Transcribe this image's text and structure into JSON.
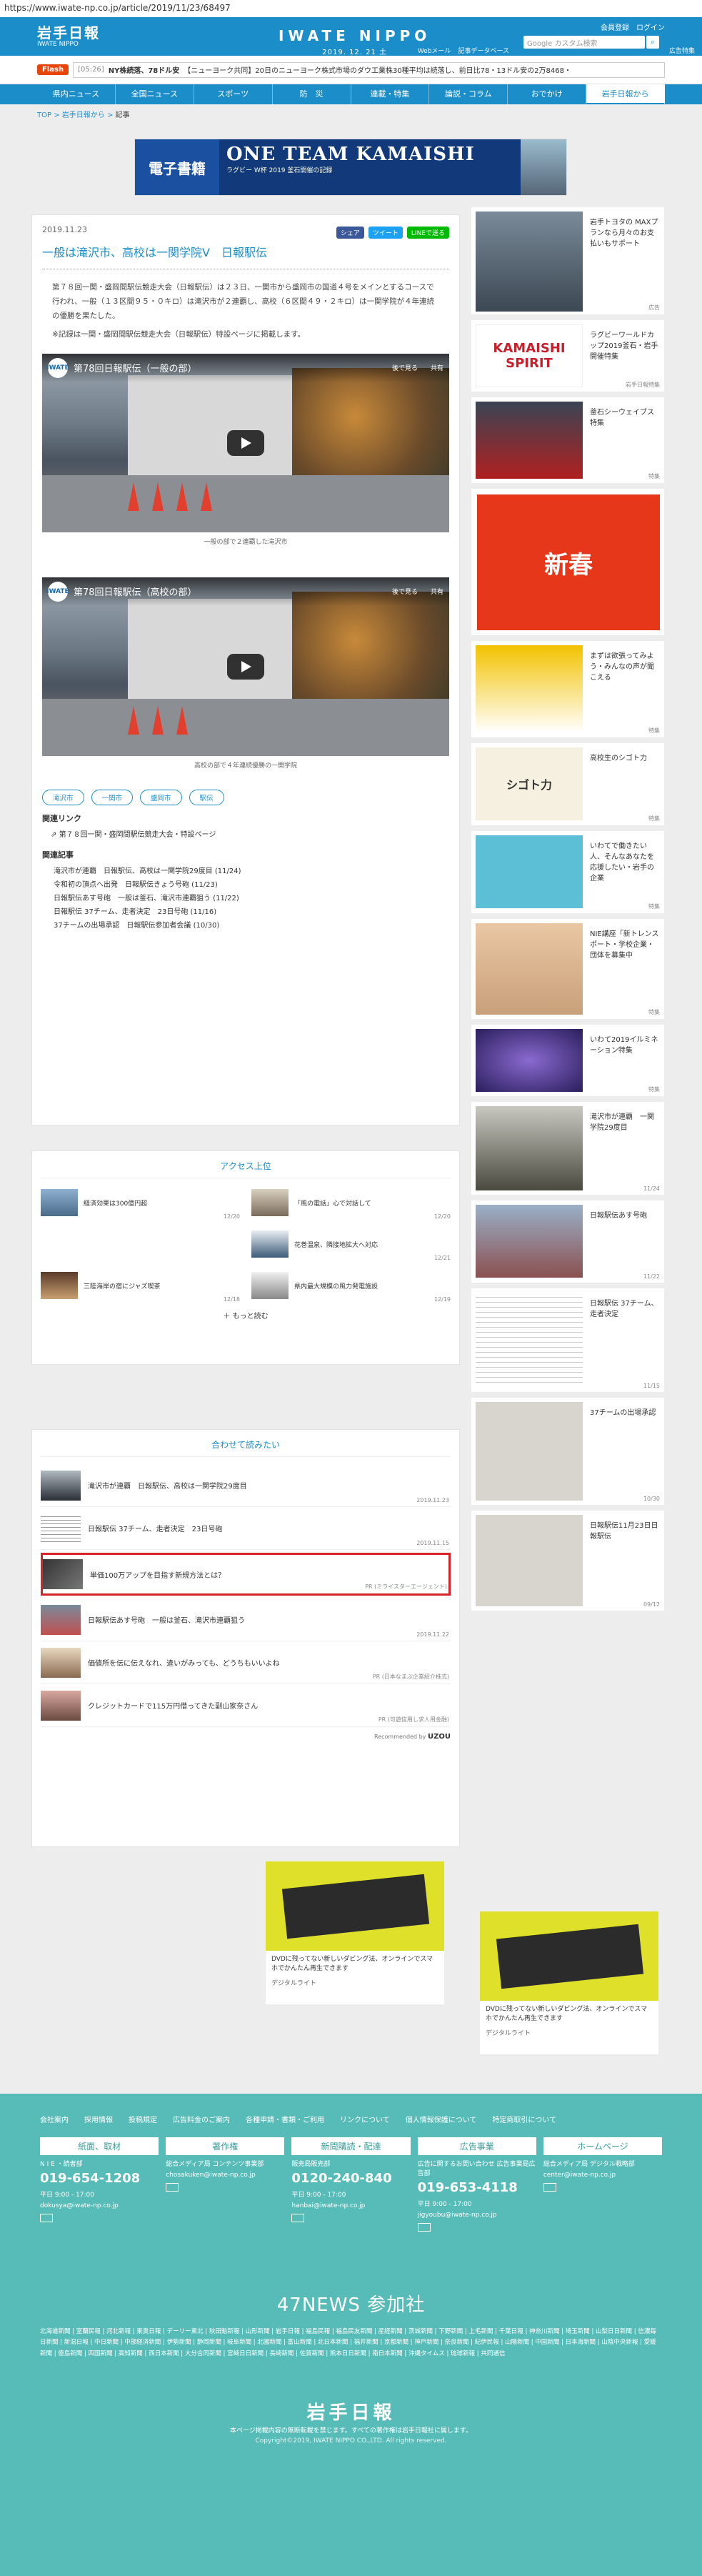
{
  "url": "https://www.iwate-np.co.jp/article/2019/11/23/68497",
  "header": {
    "logo": "岩手日報",
    "logo_sub": "IWATE NIPPO",
    "brand": "IWATE NIPPO",
    "date": "2019. 12. 21  土",
    "util_links": [
      "会員登録",
      "ログイン"
    ],
    "search_placeholder": "Google カスタム検索",
    "sub_links": [
      "Webメール",
      "記事データベース",
      "広告特集"
    ]
  },
  "ticker": {
    "flash_label": "Flash",
    "time": "[05:26]",
    "headline1": "NY株続落、78ドル安",
    "headline2": "【ニューヨーク共同】20日のニューヨーク株式市場のダウ工業株30種平均は続落し、前日比78・13ドル安の2万8468・"
  },
  "nav": [
    "県内ニュース",
    "全国ニュース",
    "スポーツ",
    "防　災",
    "連載・特集",
    "論説・コラム",
    "おでかけ",
    "岩手日報から"
  ],
  "breadcrumb": [
    "TOP",
    "岩手日報から",
    "記事"
  ],
  "banner": {
    "label": "電子書籍",
    "title": "ONE TEAM KAMAISHI",
    "sub": "ラグビー W杯 2019 釜石開催の記録"
  },
  "article": {
    "date": "2019.11.23",
    "share": [
      "シェア",
      "ツイート",
      "LINEで送る"
    ],
    "title": "一般は滝沢市、高校は一関学院V　日報駅伝",
    "body1": "第７８回一関・盛岡間駅伝競走大会（日報駅伝）は２３日、一関市から盛岡市の国道４号をメインとするコースで行われ、一般（１３区間９５・０キロ）は滝沢市が２連覇し、高校（６区間４９・２キロ）は一関学院が４年連続の優勝を果たした。",
    "body2": "※記録は一関・盛岡間駅伝競走大会（日報駅伝）特設ページに掲載します。",
    "videos": [
      {
        "title": "第78回日報駅伝（一般の部）",
        "caption": "一般の部で２連覇した滝沢市"
      },
      {
        "title": "第78回日報駅伝（高校の部）",
        "caption": "高校の部で４年連続優勝の一関学院"
      }
    ],
    "video_later": "後で見る",
    "video_share": "共有",
    "tags": [
      "滝沢市",
      "一関市",
      "盛岡市",
      "駅伝"
    ],
    "related_links_heading": "関連リンク",
    "related_link": "第７８回一関・盛岡間駅伝競走大会・特設ページ",
    "related_articles_heading": "関連記事",
    "related_articles": [
      "滝沢市が連覇　日報駅伝、高校は一関学院29度目 (11/24)",
      "令和初の頂点へ出発　日報駅伝きょう号砲 (11/23)",
      "日報駅伝あす号砲　一般は釜石、滝沢市連覇狙う (11/22)",
      "日報駅伝 37チーム、走者決定　23日号砲 (11/16)",
      "37チームの出場承認　日報駅伝参加者会議 (10/30)"
    ]
  },
  "access": {
    "heading": "アクセス上位",
    "items": [
      {
        "title": "経済効果は300億円超",
        "date": "12/20"
      },
      {
        "title": "「風の電話」心で対話して",
        "date": "12/20"
      },
      {
        "title": "",
        "date": ""
      },
      {
        "title": "花巻温泉、隣接地拡大へ対応",
        "date": "12/21"
      },
      {
        "title": "三陸海岸の宿にジャズ喫茶",
        "date": "12/18"
      },
      {
        "title": "県内最大規模の風力発電施設",
        "date": "12/19"
      }
    ],
    "more": "もっと読む"
  },
  "together": {
    "heading": "合わせて読みたい",
    "items": [
      {
        "title": "滝沢市が連覇　日報駅伝、高校は一関学院29度目",
        "date": "2019.11.23",
        "pr": ""
      },
      {
        "title": "日報駅伝 37チーム、走者決定　23日号砲",
        "date": "2019.11.15",
        "pr": ""
      },
      {
        "title": "単価100万アップを目指す新規方法とは？",
        "date": "",
        "pr": "PR (ミライスターエージェント)"
      },
      {
        "title": "日報駅伝あす号砲　一般は釜石、滝沢市連覇狙う",
        "date": "2019.11.22",
        "pr": ""
      },
      {
        "title": "価値所を伝に伝えなれ、違いがみっても、どうちもいいよね",
        "date": "",
        "pr": "PR (日本なまぶ企業紹介株式)"
      },
      {
        "title": "クレジットカードで115万円借ってきた副山家奈さん",
        "date": "",
        "pr": "PR (可遊信用し求人用金融)"
      }
    ],
    "recommended": "Recommended by",
    "uzou": "UZOU"
  },
  "ad": {
    "text": "DVDに残ってない新しいダビング法、オンラインでスマホでかんたん再生できます",
    "source": "デジタルライト"
  },
  "sidebar": [
    {
      "text": "岩手トヨタの MAXプランなら月々のお支払いもサポート",
      "label": "広告",
      "color": "#5b6a76"
    },
    {
      "text": "ラグビーワールドカップ2019釜石・岩手開催特集",
      "label": "岩手日報特集",
      "color": "#c71f2c"
    },
    {
      "text": "釜石シーウェイブス特集",
      "label": "特集",
      "color": "#3a4454"
    },
    {
      "text": "",
      "label": "",
      "color": "#e6371b"
    },
    {
      "text": "まずは欲張ってみよう・みんなの声が聞こえる",
      "label": "特集",
      "color": "#f2c200"
    },
    {
      "text": "高校生のシゴト力",
      "label": "特集",
      "color": "#f5f0df"
    },
    {
      "text": "いわてで働きたい人、そんなあなたを応援したい・岩手の企業",
      "label": "特集",
      "color": "#5cbfd5"
    },
    {
      "text": "NIE講座「新トレンスポート・学校企業・団体を募集中",
      "label": "特集",
      "color": "#eac7a4"
    },
    {
      "text": "いわて2019イルミネーション特集",
      "label": "特集",
      "color": "#2a1e5c"
    },
    {
      "text": "滝沢市が連覇　一関学院29度目",
      "label": "11/24",
      "color": "#8c8d7c"
    },
    {
      "text": "日報駅伝あす号砲",
      "label": "11/22",
      "color": "#5a7a9a"
    },
    {
      "text": "日報駅伝 37チーム、走者決定",
      "label": "11/15",
      "color": "#f7f7f7"
    },
    {
      "text": "37チームの出場承認",
      "label": "10/30",
      "color": "#d8d4ce"
    },
    {
      "text": "日報駅伝11月23日日報駅伝",
      "label": "09/12",
      "color": "#d8d4ce"
    }
  ],
  "footer": {
    "links": [
      "会社案内",
      "採用情報",
      "投稿規定",
      "広告料金のご案内",
      "各種申請・書類・ご利用",
      "リンクについて",
      "個人情報保護について",
      "特定商取引について"
    ],
    "columns": [
      {
        "title": "紙面、取材",
        "dept": "N I E ・読者部",
        "tel": "019-654-1208",
        "hours": "平日 9:00 - 17:00",
        "mail": "dokusya@iwate-np.co.jp"
      },
      {
        "title": "著作権",
        "dept": "総合メディア局 コンテンツ事業部",
        "tel": "",
        "hours": "",
        "mail": "chosakuken@iwate-np.co.jp"
      },
      {
        "title": "新聞購読・配達",
        "dept": "販売局販売部",
        "tel": "0120-240-840",
        "hours": "平日 9:00 - 17:00",
        "mail": "hanbai@iwate-np.co.jp"
      },
      {
        "title": "広告事業",
        "dept": "広告に関するお問い合わせ 広告事業局広告部",
        "tel": "019-653-4118",
        "hours": "平日 9:00 - 17:00",
        "mail": "jigyoubu@iwate-np.co.jp"
      },
      {
        "title": "ホームページ",
        "dept": "総合メディア局 デジタル戦略部",
        "tel": "",
        "hours": "",
        "mail": "center@iwate-np.co.jp"
      }
    ],
    "n47": "47NEWS 参加社",
    "papers": "北海道新聞 | 室蘭民報 | 河北新報 | 東奥日報 | デーリー東北 | 秋田魁新報 | 山形新聞 | 岩手日報 | 福島民報 | 福島民友新聞 | 産経新聞 | 茨城新聞 | 下野新聞 | 上毛新聞 | 千葉日報 | 神奈川新聞 | 埼玉新聞 | 山梨日日新聞 | 信濃毎日新聞 | 新潟日報 | 中日新聞 | 中部経済新聞 | 伊勢新聞 | 静岡新聞 | 岐阜新聞 | 北國新聞 | 富山新聞 | 北日本新聞 | 福井新聞 | 京都新聞 | 神戸新聞 | 奈良新聞 | 紀伊民報 | 山陽新聞 | 中国新聞 | 日本海新聞 | 山陰中央新報 | 愛媛新聞 | 徳島新聞 | 四国新聞 | 高知新聞 | 西日本新聞 | 大分合同新聞 | 宮崎日日新聞 | 長崎新聞 | 佐賀新聞 | 熊本日日新聞 | 南日本新聞 | 沖縄タイムス | 琉球新報 | 共同通信",
    "logo": "岩手日報",
    "note": "本ページ掲載内容の無断転載を禁じます。すべての著作権は岩手日報社に属します。",
    "copyright": "Copyright©2019, IWATE NIPPO CO.,LTD. All rights reserved."
  }
}
